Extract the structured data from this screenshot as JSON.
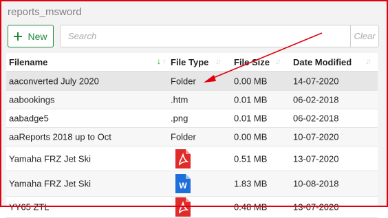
{
  "panel": {
    "title": "reports_msword"
  },
  "toolbar": {
    "new_label": "New",
    "search_placeholder": "Search",
    "clear_label": "Clear"
  },
  "table": {
    "headers": {
      "filename": "Filename",
      "filetype": "File Type",
      "filesize": "File Size",
      "modified": "Date Modified"
    },
    "rows": [
      {
        "name": "aaconverted July 2020",
        "type": "Folder",
        "size": "0.00 MB",
        "date": "14-07-2020",
        "icon": "",
        "selected": true
      },
      {
        "name": "aabookings",
        "type": ".htm",
        "size": "0.01 MB",
        "date": "06-02-2018",
        "icon": ""
      },
      {
        "name": "aabadge5",
        "type": ".png",
        "size": "0.01 MB",
        "date": "06-02-2018",
        "icon": ""
      },
      {
        "name": "aaReports 2018 up to Oct",
        "type": "Folder",
        "size": "0.00 MB",
        "date": "10-07-2020",
        "icon": ""
      },
      {
        "name": "Yamaha FRZ Jet Ski",
        "type": "",
        "size": "0.51 MB",
        "date": "13-07-2020",
        "icon": "pdf-icon"
      },
      {
        "name": "Yamaha FRZ Jet Ski",
        "type": "",
        "size": "1.83 MB",
        "date": "10-08-2018",
        "icon": "word-icon"
      },
      {
        "name": "YY65 ZTL",
        "type": "",
        "size": "0.48 MB",
        "date": "13-07-2020",
        "icon": "pdf-icon"
      }
    ]
  },
  "colors": {
    "accent_green": "#1e8a3c",
    "annotation_red": "#e0000f",
    "pdf_red": "#e02b2b",
    "word_blue": "#1e6fd9"
  }
}
